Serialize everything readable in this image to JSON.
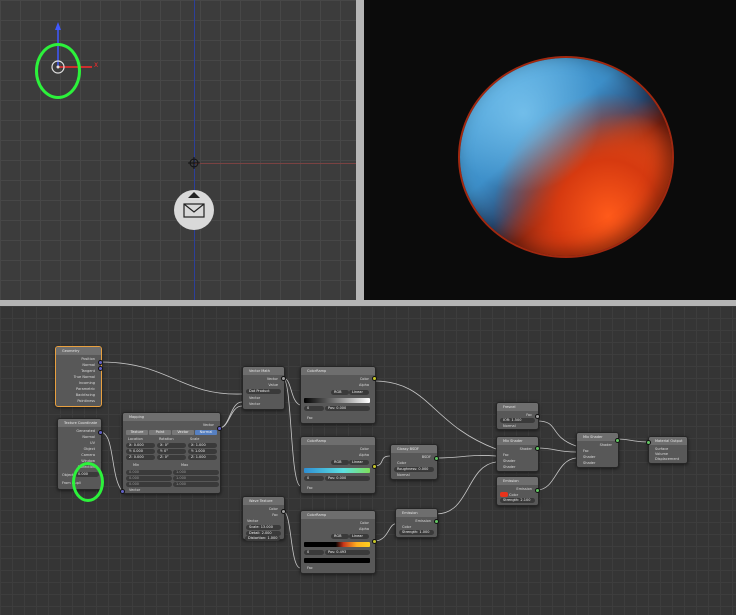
{
  "viewport_3d": {
    "axis_x_label": "X",
    "lamp_icon": "lamp-icon",
    "camera_icon": "envelope-icon"
  },
  "colors": {
    "annotation": "#2cf23b",
    "socket_color": "#c7c729",
    "socket_shader": "#63c763",
    "socket_vector": "#6363c7",
    "socket_grey": "#a1a1a1"
  },
  "node_editor": {
    "geometry": {
      "title": "Geometry",
      "outputs": [
        "Position",
        "Normal",
        "Tangent",
        "True Normal",
        "Incoming",
        "Parametric",
        "Backfacing",
        "Pointiness"
      ]
    },
    "texcoord": {
      "title": "Texture Coordinate",
      "outputs": [
        "Generated",
        "Normal",
        "UV",
        "Object",
        "Camera",
        "Window",
        "Reflection"
      ],
      "object_label": "Object",
      "from_dupli_label": "From Dupli",
      "value": "0.000"
    },
    "mapping": {
      "title": "Mapping",
      "vector_label": "Vector",
      "tabs": [
        "Texture",
        "Point",
        "Vector",
        "Normal"
      ],
      "col_location": "Location",
      "col_rotation": "Rotation",
      "col_scale": "Scale",
      "loc": [
        "X: 0.000",
        "Y: 0.000",
        "Z: 0.000"
      ],
      "rot": [
        "X: 0°",
        "Y: 0°",
        "Z: 0°"
      ],
      "scl": [
        "X: 1.000",
        "Y: 1.000",
        "Z: 1.000"
      ],
      "min_label": "Min",
      "max_label": "Max",
      "zeros": [
        "0.000",
        "0.000",
        "0.000"
      ],
      "ones": [
        "1.000",
        "1.000",
        "1.000"
      ],
      "out_label": "Vector"
    },
    "vector_math": {
      "title": "Vector Math",
      "out_vector": "Vector",
      "out_value": "Value",
      "op": "Dot Product",
      "in1": "Vector",
      "in2": "Vector"
    },
    "ramp1": {
      "title": "ColorRamp",
      "out_color": "Color",
      "out_alpha": "Alpha",
      "mode": "RGB",
      "interp": "Linear",
      "pos_label": "0",
      "pos_value": "Pos: 0.000",
      "fac": "Fac"
    },
    "ramp2": {
      "title": "ColorRamp",
      "out_color": "Color",
      "out_alpha": "Alpha",
      "mode": "RGB",
      "interp": "Linear",
      "pos_label": "0",
      "pos_value": "Pos: 0.000",
      "fac": "Fac"
    },
    "ramp3": {
      "title": "ColorRamp",
      "out_color": "Color",
      "out_alpha": "Alpha",
      "mode": "RGB",
      "interp": "Linear",
      "pos_label": "0",
      "pos_value": "Pos: 0.493",
      "fac": "Fac"
    },
    "wave": {
      "title": "Wave Texture",
      "out_color": "Color",
      "out_fac": "Fac",
      "vector": "Vector",
      "scale": "Scale: 13.000",
      "detail": "Detail: 2.000",
      "distortion": "Distortion: 1.000"
    },
    "glossy": {
      "title": "Glossy BSDF",
      "out": "BSDF",
      "color": "Color",
      "roughness": "Roughness: 0.000",
      "normal": "Normal"
    },
    "emission1": {
      "title": "Emission",
      "out": "Emission",
      "color": "Color",
      "strength": "Strength: 1.000"
    },
    "fresnel": {
      "title": "Fresnel",
      "out": "Fac",
      "ior": "IOR: 1.500",
      "normal": "Normal"
    },
    "mix1": {
      "title": "Mix Shader",
      "out": "Shader",
      "fac": "Fac",
      "s1": "Shader",
      "s2": "Shader"
    },
    "emission2": {
      "title": "Emission",
      "out": "Emission",
      "color": "Color",
      "strength": "Strength: 2.100"
    },
    "mix2": {
      "title": "Mix Shader",
      "out": "Shader",
      "fac": "Fac",
      "s1": "Shader",
      "s2": "Shader"
    },
    "output": {
      "title": "Material Output",
      "inputs": [
        "Surface",
        "Volume",
        "Displacement"
      ]
    }
  }
}
